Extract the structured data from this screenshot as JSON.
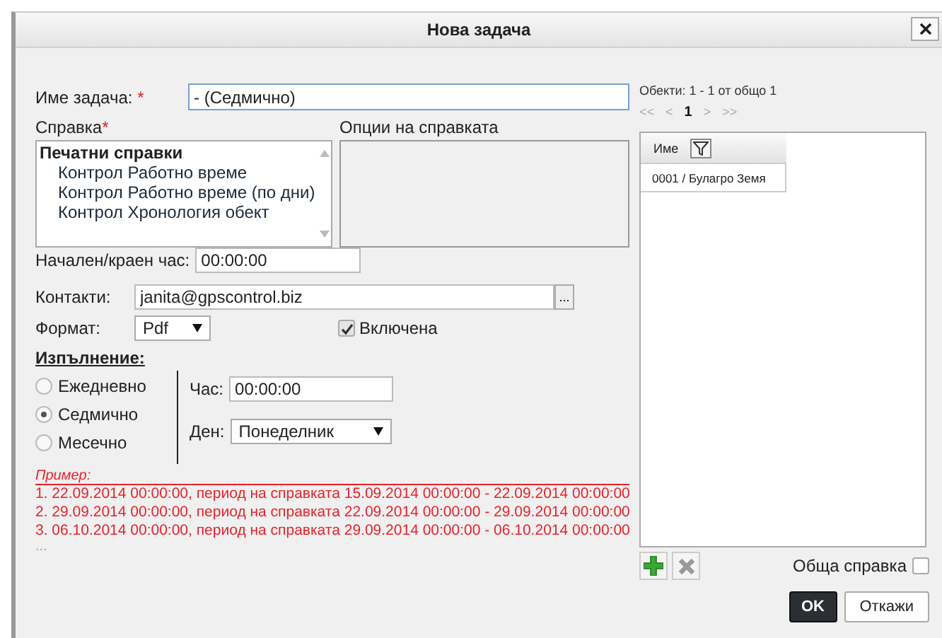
{
  "window": {
    "title": "Нова задача"
  },
  "task_name": {
    "label": "Име задача:",
    "required_mark": "*",
    "value": "- (Седмично)"
  },
  "report": {
    "label": "Справка",
    "required_mark": "*",
    "tree": [
      {
        "label": "Печатни справки",
        "children": [
          {
            "label": "Контрол Работно време"
          },
          {
            "label": "Контрол Работно време (по дни)"
          },
          {
            "label": "Контрол Хронология обект"
          }
        ]
      }
    ]
  },
  "report_options": {
    "label": "Опции на справката"
  },
  "start_end_time": {
    "label": "Начален/краен час:",
    "value": "00:00:00"
  },
  "contacts": {
    "label": "Контакти:",
    "value": "janita@gpscontrol.biz",
    "browse": "..."
  },
  "format": {
    "label": "Формат:",
    "value": "Pdf"
  },
  "enabled": {
    "label": "Включена",
    "checked": true
  },
  "execution": {
    "title": "Изпълнение:",
    "options": [
      {
        "label": "Ежедневно",
        "selected": false
      },
      {
        "label": "Седмично",
        "selected": true
      },
      {
        "label": "Месечно",
        "selected": false
      }
    ],
    "time": {
      "label": "Час:",
      "value": "00:00:00"
    },
    "day": {
      "label": "Ден:",
      "value": "Понеделник"
    }
  },
  "example": {
    "title": "Пример:",
    "lines": [
      "1. 22.09.2014 00:00:00, период на справката 15.09.2014 00:00:00 - 22.09.2014 00:00:00",
      "2. 29.09.2014 00:00:00, период на справката 22.09.2014 00:00:00 - 29.09.2014 00:00:00",
      "3. 06.10.2014 00:00:00, период на справката 29.09.2014 00:00:00 - 06.10.2014 00:00:00"
    ],
    "more": "..."
  },
  "objects": {
    "summary": "Обекти: 1 - 1 от общо 1",
    "pager": [
      {
        "label": "<<",
        "selected": false
      },
      {
        "label": "<",
        "selected": false
      },
      {
        "label": "1",
        "selected": true
      },
      {
        "label": ">",
        "selected": false
      },
      {
        "label": ">>",
        "selected": false
      }
    ],
    "column": "Име",
    "rows": [
      "0001 / Булагро Земя"
    ]
  },
  "general_report": {
    "label": "Обща справка",
    "checked": false
  },
  "buttons": [
    {
      "label": "OK",
      "kind": "primary"
    },
    {
      "label": "Откажи",
      "kind": "secondary"
    }
  ]
}
